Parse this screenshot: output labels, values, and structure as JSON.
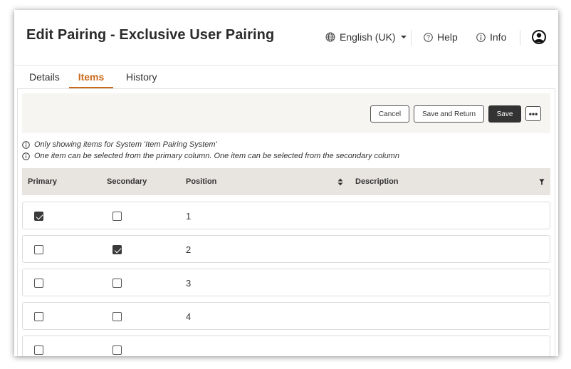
{
  "header": {
    "title": "Edit Pairing - Exclusive User Pairing",
    "language": "English (UK)",
    "help": "Help",
    "info": "Info"
  },
  "tabs": [
    {
      "label": "Details",
      "active": false
    },
    {
      "label": "Items",
      "active": true
    },
    {
      "label": "History",
      "active": false
    }
  ],
  "toolbar": {
    "cancel": "Cancel",
    "save_and_return": "Save and Return",
    "save": "Save",
    "more": "•••"
  },
  "notes": [
    "Only showing items for System 'Item Pairing System'",
    "One item can be selected from the primary column. One item can be selected from the secondary column"
  ],
  "table": {
    "columns": [
      "Primary",
      "Secondary",
      "Position",
      "Description"
    ],
    "rows": [
      {
        "primary": true,
        "secondary": false,
        "position": "1",
        "description": ""
      },
      {
        "primary": false,
        "secondary": true,
        "position": "2",
        "description": ""
      },
      {
        "primary": false,
        "secondary": false,
        "position": "3",
        "description": ""
      },
      {
        "primary": false,
        "secondary": false,
        "position": "4",
        "description": ""
      },
      {
        "primary": false,
        "secondary": false,
        "position": "",
        "description": ""
      }
    ]
  },
  "colors": {
    "accent": "#c96a1b",
    "table_header_bg": "#e8e5e1",
    "toolbar_bg": "#f7f5f2",
    "primary_button": "#333333"
  }
}
